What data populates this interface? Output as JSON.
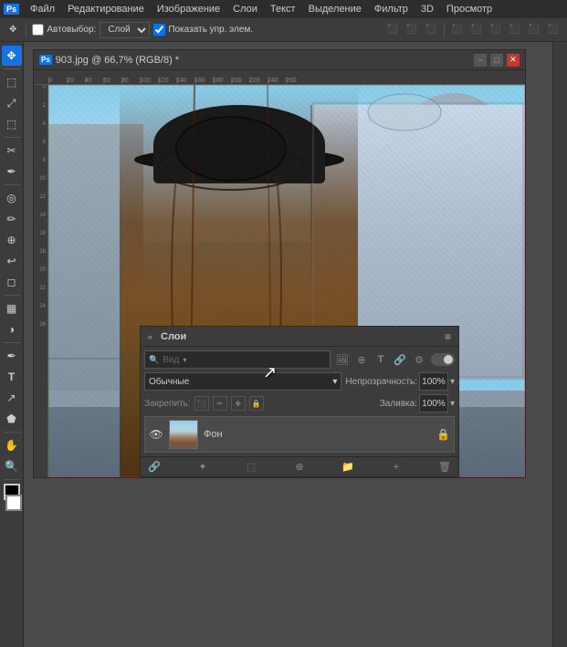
{
  "menubar": {
    "logo": "Ps",
    "items": [
      {
        "label": "Файл"
      },
      {
        "label": "Редактирование"
      },
      {
        "label": "Изображение"
      },
      {
        "label": "Слои"
      },
      {
        "label": "Текст"
      },
      {
        "label": "Выделение"
      },
      {
        "label": "Фильтр"
      },
      {
        "label": "3D"
      },
      {
        "label": "Просмотр"
      }
    ]
  },
  "toolbar": {
    "autoselect_label": "Автовыбор:",
    "layer_label": "Слой",
    "show_controls_label": "Показать упр. элем."
  },
  "document": {
    "ps_badge": "Ps",
    "title": "903.jpg @ 66,7% (RGB/8) *",
    "minimize": "−",
    "maximize": "□",
    "close": "✕"
  },
  "layers_panel": {
    "title": "Слои",
    "collapse_icon": "«",
    "menu_icon": "≡",
    "search_placeholder": "Вид",
    "blend_mode": "Обычные",
    "opacity_label": "Непрозрачность:",
    "opacity_value": "100%",
    "lock_label": "Закрепить:",
    "fill_label": "Заливка:",
    "fill_value": "100%",
    "layer_name": "Фон",
    "filter_icons": [
      "🖼",
      "🔵",
      "T",
      "🔗",
      "⚙"
    ]
  },
  "tools": [
    {
      "icon": "✥",
      "name": "move-tool"
    },
    {
      "icon": "⬚",
      "name": "selection-tool"
    },
    {
      "icon": "⤢",
      "name": "crop-tool"
    },
    {
      "icon": "✏",
      "name": "brush-tool"
    },
    {
      "icon": "⬛",
      "name": "clone-tool"
    },
    {
      "icon": "◻",
      "name": "eraser-tool"
    },
    {
      "icon": "🪣",
      "name": "fill-tool"
    },
    {
      "icon": "◎",
      "name": "dodge-tool"
    },
    {
      "icon": "P",
      "name": "pen-tool"
    },
    {
      "icon": "T",
      "name": "text-tool"
    },
    {
      "icon": "⬚",
      "name": "shape-tool"
    },
    {
      "icon": "☞",
      "name": "hand-tool"
    },
    {
      "icon": "⬚",
      "name": "foreground-bg"
    }
  ],
  "status": {
    "cursor_visible": true
  }
}
